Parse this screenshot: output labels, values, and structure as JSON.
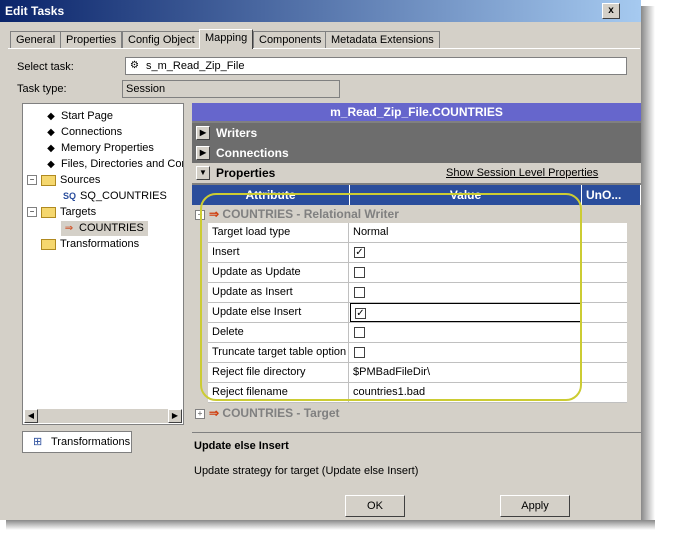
{
  "window": {
    "title": "Edit Tasks",
    "close": "x"
  },
  "tabs": [
    "General",
    "Properties",
    "Config Object",
    "Mapping",
    "Components",
    "Metadata Extensions"
  ],
  "form": {
    "select_task_label": "Select task:",
    "select_task_value": "s_m_Read_Zip_File",
    "task_type_label": "Task type:",
    "task_type_value": "Session"
  },
  "tree": {
    "items": [
      {
        "label": "Start Page"
      },
      {
        "label": "Connections"
      },
      {
        "label": "Memory Properties"
      },
      {
        "label": "Files, Directories and Com"
      },
      {
        "label": "Sources"
      },
      {
        "label": "SQ_COUNTRIES"
      },
      {
        "label": "Targets"
      },
      {
        "label": "COUNTRIES"
      },
      {
        "label": "Transformations"
      }
    ],
    "sq_badge": "SQ"
  },
  "bottom_tab": "Transformations",
  "mapping": {
    "title": "m_Read_Zip_File.COUNTRIES",
    "sections": [
      "Writers",
      "Connections",
      "Properties"
    ],
    "show_link": "Show Session Level Properties",
    "columns": [
      "Attribute",
      "Value",
      "UnO..."
    ],
    "group1": "COUNTRIES - Relational Writer",
    "group2": "COUNTRIES - Target",
    "rows": [
      {
        "attr": "Target load type",
        "value": "Normal"
      },
      {
        "attr": "Insert",
        "checked": true
      },
      {
        "attr": "Update as Update",
        "checked": false
      },
      {
        "attr": "Update as Insert",
        "checked": false
      },
      {
        "attr": "Update else Insert",
        "checked": true
      },
      {
        "attr": "Delete",
        "checked": false
      },
      {
        "attr": "Truncate target table option",
        "checked": false
      },
      {
        "attr": "Reject file directory",
        "value": "$PMBadFileDir\\"
      },
      {
        "attr": "Reject filename",
        "value": "countries1.bad"
      }
    ]
  },
  "description": {
    "title": "Update else Insert",
    "text": "Update strategy for target (Update else Insert)"
  },
  "buttons": {
    "ok": "OK",
    "apply": "Apply"
  },
  "colors": {
    "title_start": "#0a246a",
    "title_end": "#a6caf0",
    "header_blue": "#2a4d9c",
    "map_title": "#6666cc",
    "highlight": "#cccc33"
  }
}
